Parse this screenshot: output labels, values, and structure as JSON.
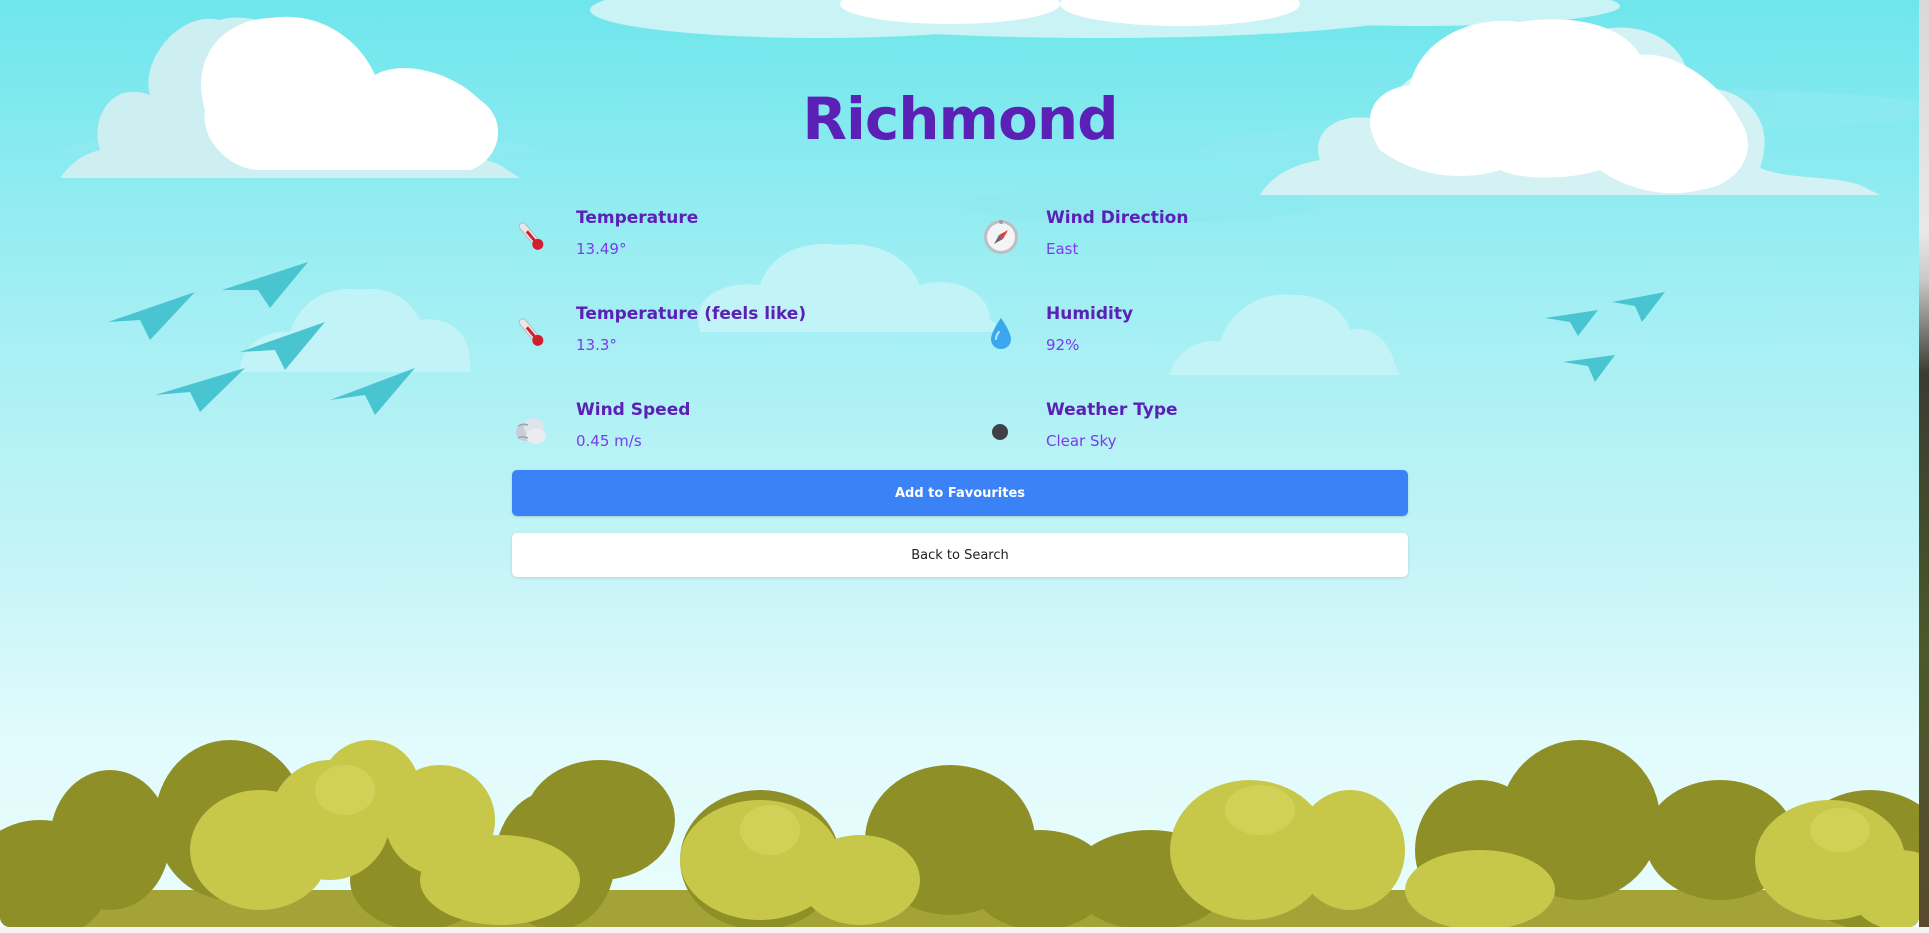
{
  "city": {
    "name": "Richmond"
  },
  "stats": [
    {
      "label": "Temperature",
      "value": "13.49°",
      "icon": "thermometer-icon"
    },
    {
      "label": "Wind Direction",
      "value": "East",
      "icon": "compass-icon"
    },
    {
      "label": "Temperature (feels like)",
      "value": "13.3°",
      "icon": "thermometer-icon"
    },
    {
      "label": "Humidity",
      "value": "92%",
      "icon": "droplet-icon"
    },
    {
      "label": "Wind Speed",
      "value": "0.45 m/s",
      "icon": "wind-cloud-icon"
    },
    {
      "label": "Weather Type",
      "value": "Clear Sky",
      "icon": "weather-dot-icon"
    }
  ],
  "actions": {
    "add_favourite_label": "Add to Favourites",
    "back_label": "Back to Search"
  },
  "colors": {
    "title": "#5b21b6",
    "value": "#7c3aed",
    "primary_button": "#3b82f6",
    "sky_top": "#6ee6ec",
    "bush_dark": "#8f8f28",
    "bush_light": "#c7c84a"
  }
}
